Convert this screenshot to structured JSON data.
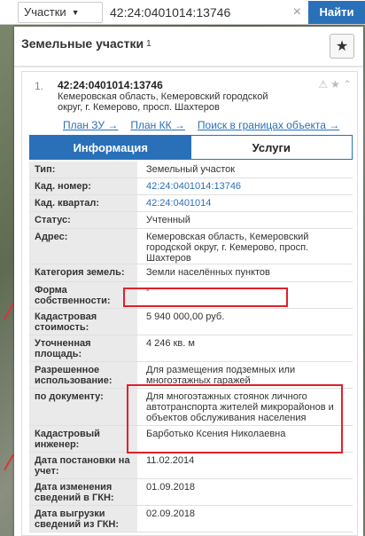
{
  "topbar": {
    "select_label": "Участки",
    "search_value": "42:24:0401014:13746",
    "find_button": "Найти",
    "clear_symbol": "×"
  },
  "panel": {
    "title": "Земельные участки",
    "count_sup": "1",
    "star_symbol": "★"
  },
  "card": {
    "index": "1.",
    "cad_number": "42:24:0401014:13746",
    "address": "Кемеровская область, Кемеровский городской округ, г. Кемерово, просп. Шахтеров",
    "links": [
      "План ЗУ →",
      "План КК →",
      "Поиск в границах объекта →"
    ],
    "tabs": [
      "Информация",
      "Услуги"
    ]
  },
  "rows": [
    {
      "k": "Тип:",
      "v": "Земельный участок"
    },
    {
      "k": "Кад. номер:",
      "v": "42:24:0401014:13746",
      "link": true
    },
    {
      "k": "Кад. квартал:",
      "v": "42:24:0401014",
      "link": true
    },
    {
      "k": "Статус:",
      "v": "Учтенный"
    },
    {
      "k": "Адрес:",
      "v": "Кемеровская область, Кемеровский городской округ, г. Кемерово, просп. Шахтеров"
    },
    {
      "k": "Категория земель:",
      "v": "Земли населённых пунктов"
    },
    {
      "k": "Форма собственности:",
      "v": "-"
    },
    {
      "k": "Кадастровая стоимость:",
      "v": "5 940 000,00 руб."
    },
    {
      "k": "Уточненная площадь:",
      "v": "4 246 кв. м"
    },
    {
      "k": "Разрешенное использование:",
      "v": "Для размещения подземных или многоэтажных гаражей"
    },
    {
      "k": "по документу:",
      "v": "Для многоэтажных стоянок личного автотранспорта жителей микрорайонов и объектов обслуживания населения"
    },
    {
      "k": "Кадастровый инженер:",
      "v": "Барботько Ксения Николаевна"
    },
    {
      "k": "Дата постановки на учет:",
      "v": "11.02.2014"
    },
    {
      "k": "Дата изменения сведений в ГКН:",
      "v": "01.09.2018"
    },
    {
      "k": "Дата выгрузки сведений из ГКН:",
      "v": "02.09.2018"
    }
  ],
  "colors": {
    "accent": "#2a70b8",
    "highlight": "#e0202a"
  }
}
